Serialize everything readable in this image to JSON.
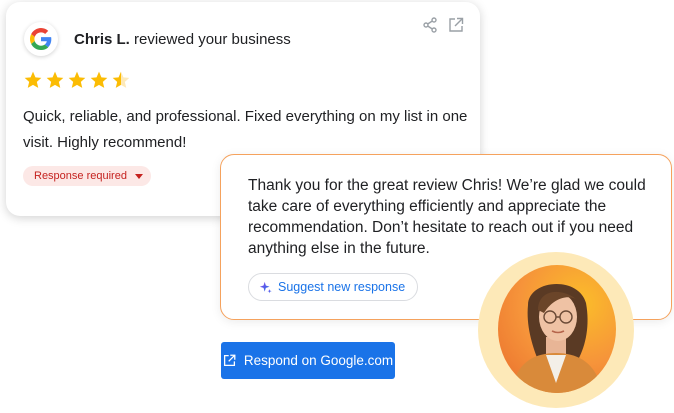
{
  "review": {
    "reviewer_name": "Chris L.",
    "header_suffix": " reviewed your business",
    "rating": 4.5,
    "text": "Quick, reliable, and professional. Fixed everything on my list in one visit. Highly recommend!",
    "status_badge": "Response required",
    "icons": [
      "google-icon",
      "share-icon",
      "open-external-icon",
      "star-icon",
      "chevron-down-icon"
    ]
  },
  "response": {
    "text": "Thank you for the great review Chris! We’re glad we could take care of everything efficiently and appreciate the recommendation. Don’t hesitate to reach out if you need anything else in the future.",
    "suggest_label": "Suggest new response"
  },
  "actions": {
    "respond_label": "Respond on Google.com"
  },
  "colors": {
    "star": "#fbbc04",
    "primary": "#1a73e8",
    "badge_bg": "#fce8e6",
    "badge_text": "#c5221f",
    "response_border": "#f5a25d",
    "avatar_ring": "#fde9b8"
  }
}
